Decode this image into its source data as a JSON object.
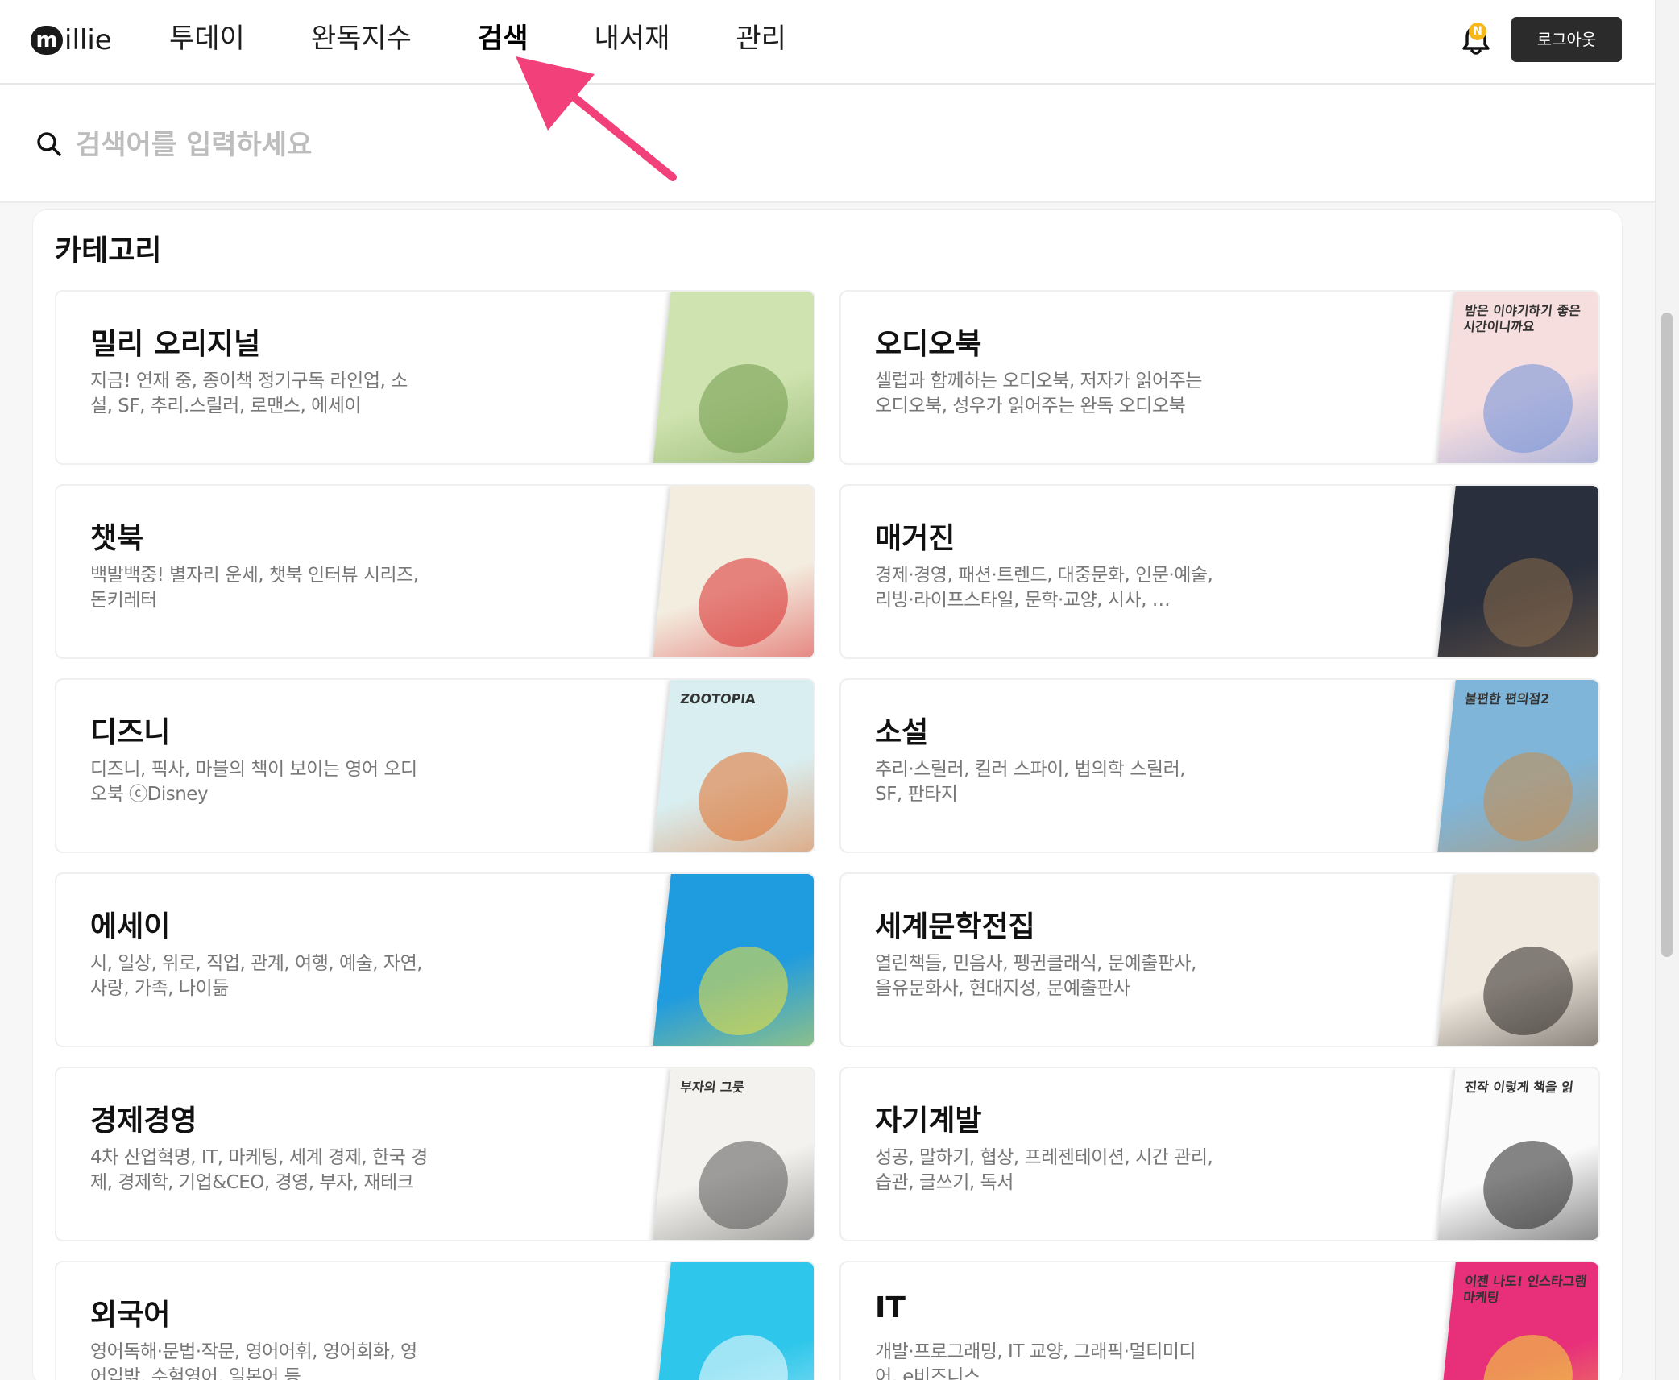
{
  "header": {
    "logo_text": "illie",
    "logo_mark": "m",
    "nav": [
      {
        "label": "투데이"
      },
      {
        "label": "완독지수"
      },
      {
        "label": "검색"
      },
      {
        "label": "내서재"
      },
      {
        "label": "관리"
      }
    ],
    "active_nav": "검색",
    "bell_badge": "N",
    "logout_label": "로그아웃"
  },
  "search": {
    "placeholder": "검색어를 입력하세요",
    "value": ""
  },
  "category": {
    "title": "카테고리",
    "items": [
      {
        "title": "밀리 오리지널",
        "desc": "지금! 연재 중, 종이책 정기구독 라인업, 소설, SF, 추리.스릴러, 로맨스, 에세이",
        "cover_color": "#cfe3b0",
        "cover_accent": "#6f9a4a"
      },
      {
        "title": "오디오북",
        "desc": "셀럽과 함께하는 오디오북, 저자가 읽어주는 오디오북, 성우가 읽어주는 완독 오디오북",
        "cover_color": "#f7dede",
        "cover_accent": "#6f8fd8",
        "cover_text": "밤은 이야기하기 좋은 시간이니까요"
      },
      {
        "title": "챗북",
        "desc": "백발백중! 별자리 운세, 챗북 인터뷰 시리즈, 돈키레터",
        "cover_color": "#f3ede0",
        "cover_accent": "#d92a2a"
      },
      {
        "title": "매거진",
        "desc": "경제·경영, 패션·트렌드, 대중문화, 인문·예술, 리빙·라이프스타일, 문학·교양, 시사, …",
        "cover_color": "#2a2f3d",
        "cover_accent": "#8a6b4a"
      },
      {
        "title": "디즈니",
        "desc": "디즈니, 픽사, 마블의 책이 보이는 영어 오디오북 ⓒDisney",
        "cover_color": "#d9eef0",
        "cover_accent": "#e0702a",
        "cover_text": "ZOOTOPIA"
      },
      {
        "title": "소설",
        "desc": "추리·스릴러, 킬러 스파이, 법의학 스릴러, SF, 판타지",
        "cover_color": "#7fb5d8",
        "cover_accent": "#c98b4a",
        "cover_text": "불편한 편의점2"
      },
      {
        "title": "에세이",
        "desc": "시, 일상, 위로, 직업, 관계, 여행, 예술, 자연, 사랑, 가족, 나이듦",
        "cover_color": "#1f9be0",
        "cover_accent": "#f3e23a"
      },
      {
        "title": "세계문학전집",
        "desc": "열린책들, 민음사, 펭귄클래식, 문예출판사, 을유문화사, 현대지성, 문예출판사",
        "cover_color": "#efe9df",
        "cover_accent": "#2a2520"
      },
      {
        "title": "경제경영",
        "desc": "4차 산업혁명, IT, 마케팅, 세계 경제, 한국 경제, 경제학, 기업&CEO, 경영, 부자, 재테크",
        "cover_color": "#f4f2ee",
        "cover_accent": "#555555",
        "cover_text": "부자의 그릇"
      },
      {
        "title": "자기계발",
        "desc": "성공, 말하기, 협상, 프레젠테이션, 시간 관리, 습관, 글쓰기, 독서",
        "cover_color": "#fafafa",
        "cover_accent": "#222222",
        "cover_text": "진작 이렇게 책을 읽"
      },
      {
        "title": "외국어",
        "desc": "영어독해·문법·작문, 영어어휘, 영어회화, 영어입밖, 수험영어, 일본어 등",
        "cover_color": "#2ec6ea",
        "cover_accent": "#ffffff"
      },
      {
        "title": "IT",
        "desc": "개발·프로그래밍, IT 교양, 그래픽·멀티미디어, e비즈니스",
        "cover_color": "#e8307a",
        "cover_accent": "#f3e23a",
        "cover_text": "이젠 나도! 인스타그램 마케팅"
      }
    ]
  },
  "colors": {
    "accent_arrow": "#f2407a",
    "logout_bg": "#2b2b2b",
    "bell_badge": "#f5b71a"
  },
  "icons": {
    "search": "search-icon",
    "bell": "bell-icon"
  }
}
